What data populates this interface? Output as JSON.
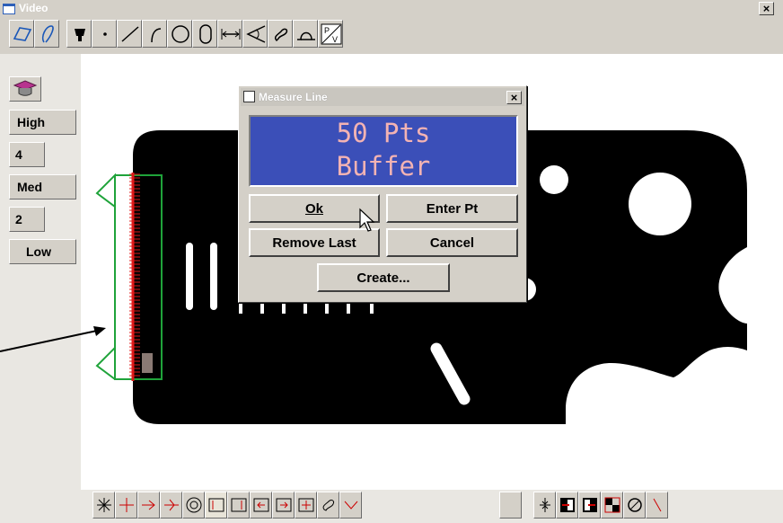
{
  "window": {
    "title": "Video",
    "close_label": "×"
  },
  "toolbar": {
    "icons": [
      "rectangle-select-icon",
      "lasso-select-icon",
      "probe-icon",
      "point-icon",
      "line-icon",
      "arc-icon",
      "circle-icon",
      "slot-icon",
      "distance-icon",
      "angle-icon",
      "contour-icon",
      "profile-icon",
      "pv-icon"
    ]
  },
  "left_panel": {
    "items": [
      {
        "label": ""
      },
      {
        "label": "High"
      },
      {
        "label": "4"
      },
      {
        "label": "Med"
      },
      {
        "label": "2"
      },
      {
        "label": "Low"
      }
    ]
  },
  "dialog": {
    "title": "Measure Line",
    "close_label": "×",
    "display_line1": "50 Pts",
    "display_line2": "Buffer",
    "ok_label": "Ok",
    "enter_pt_label": "Enter Pt",
    "remove_last_label": "Remove Last",
    "cancel_label": "Cancel",
    "create_label": "Create..."
  },
  "colors": {
    "dialog_display_bg": "#3b4fb8",
    "dialog_display_text": "#f3b3b3",
    "edge_points": "#e01818",
    "selection_box": "#1fa33a",
    "part": "#000000"
  }
}
